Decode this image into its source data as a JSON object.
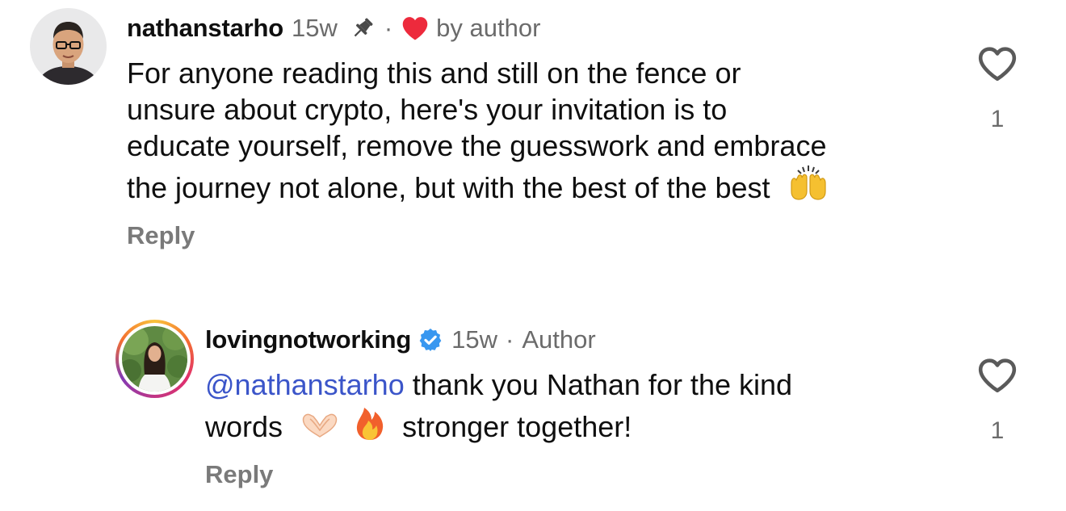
{
  "comments": [
    {
      "username": "nathanstarho",
      "time": "15w",
      "liked_by_author_label": "by author",
      "text_lines": [
        "For anyone reading this and still on the fence or",
        "unsure about crypto, here's your invitation is to",
        "educate yourself, remove the guesswork and embrace",
        "the journey not alone, but with the best of the best"
      ],
      "trailing_emoji": "raising-hands-emoji",
      "reply_label": "Reply",
      "like_count": "1",
      "pinned": true
    },
    {
      "username": "lovingnotworking",
      "verified": true,
      "time": "15w",
      "author_label": "Author",
      "mention": "@nathanstarho",
      "text_line_1": " thank you Nathan for the kind",
      "text_line_2_start": "words",
      "text_line_2_end": "stronger together!",
      "emojis": [
        "heart-hands-emoji",
        "fire-emoji"
      ],
      "reply_label": "Reply",
      "like_count": "1"
    }
  ],
  "colors": {
    "mention": "#3b55c9",
    "heart_red": "#ed2a3c",
    "verified_blue": "#3897f0",
    "muted": "#6b6b6b"
  }
}
